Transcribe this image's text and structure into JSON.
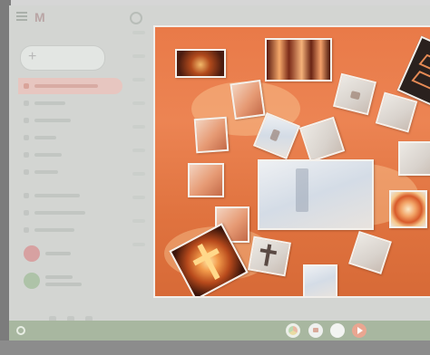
{
  "mail_app": {
    "logo_text": "M",
    "nav_items": [
      {
        "id": "inbox",
        "active": true
      },
      {
        "id": "starred",
        "active": false
      },
      {
        "id": "snoozed",
        "active": false
      },
      {
        "id": "sent",
        "active": false
      },
      {
        "id": "drafts",
        "active": false
      },
      {
        "id": "more",
        "active": false
      },
      {
        "id": "category-1",
        "active": false
      },
      {
        "id": "category-2",
        "active": false
      },
      {
        "id": "category-3",
        "active": false
      }
    ]
  },
  "photo_collage": {
    "background_color": "#e97a48",
    "tile_count": 21
  },
  "taskbar": {
    "accent": "#a8b7a0",
    "icons": [
      "start-icon",
      "chrome-icon",
      "chat-icon",
      "circle-app-icon",
      "play-icon"
    ]
  }
}
